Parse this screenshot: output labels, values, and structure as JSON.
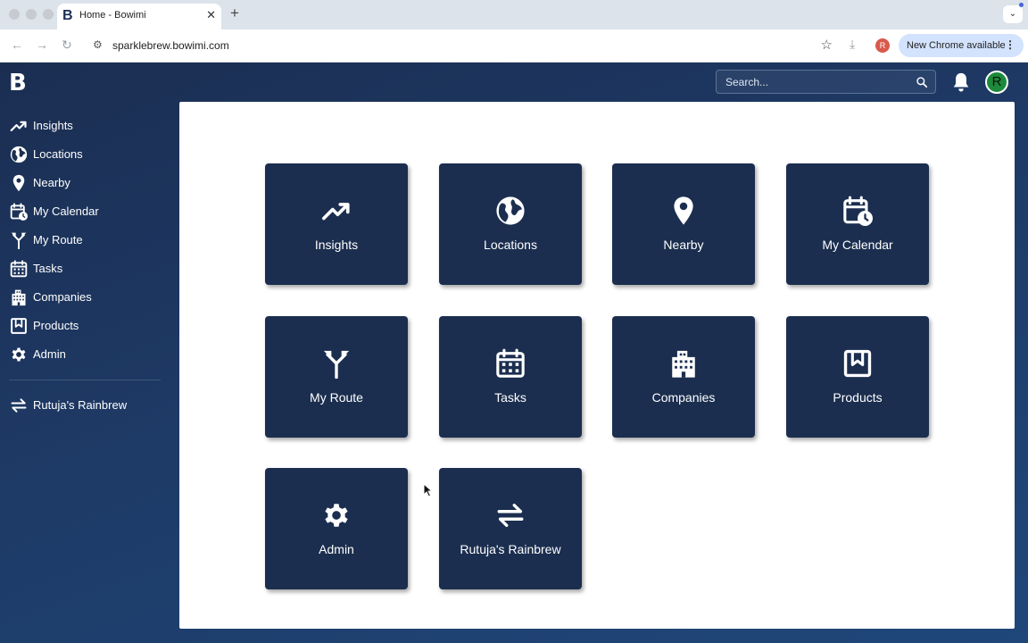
{
  "browser": {
    "tab_title": "Home - Bowimi",
    "tab_favicon": "B",
    "url": "sparklebrew.bowimi.com",
    "profile_initial": "R",
    "update_label": "New Chrome available"
  },
  "app": {
    "logo": "B",
    "search_placeholder": "Search...",
    "avatar_initial": "R",
    "brand_color": "#1b2e4f",
    "avatar_color": "#1b8a3a"
  },
  "sidebar": {
    "items": [
      {
        "label": "Insights",
        "icon": "trending-up-icon"
      },
      {
        "label": "Locations",
        "icon": "globe-icon"
      },
      {
        "label": "Nearby",
        "icon": "map-pin-icon"
      },
      {
        "label": "My Calendar",
        "icon": "calendar-clock-icon"
      },
      {
        "label": "My Route",
        "icon": "route-fork-icon"
      },
      {
        "label": "Tasks",
        "icon": "calendar-grid-icon"
      },
      {
        "label": "Companies",
        "icon": "building-icon"
      },
      {
        "label": "Products",
        "icon": "bookmark-book-icon"
      },
      {
        "label": "Admin",
        "icon": "gear-icon"
      }
    ],
    "switch_item": {
      "label": "Rutuja's Rainbrew",
      "icon": "swap-arrows-icon"
    }
  },
  "tiles": [
    {
      "label": "Insights",
      "icon": "trending-up-icon"
    },
    {
      "label": "Locations",
      "icon": "globe-icon"
    },
    {
      "label": "Nearby",
      "icon": "map-pin-icon"
    },
    {
      "label": "My Calendar",
      "icon": "calendar-clock-icon"
    },
    {
      "label": "My Route",
      "icon": "route-fork-icon"
    },
    {
      "label": "Tasks",
      "icon": "calendar-grid-icon"
    },
    {
      "label": "Companies",
      "icon": "building-icon"
    },
    {
      "label": "Products",
      "icon": "bookmark-book-icon"
    },
    {
      "label": "Admin",
      "icon": "gear-icon"
    },
    {
      "label": "Rutuja's Rainbrew",
      "icon": "swap-arrows-icon"
    }
  ]
}
